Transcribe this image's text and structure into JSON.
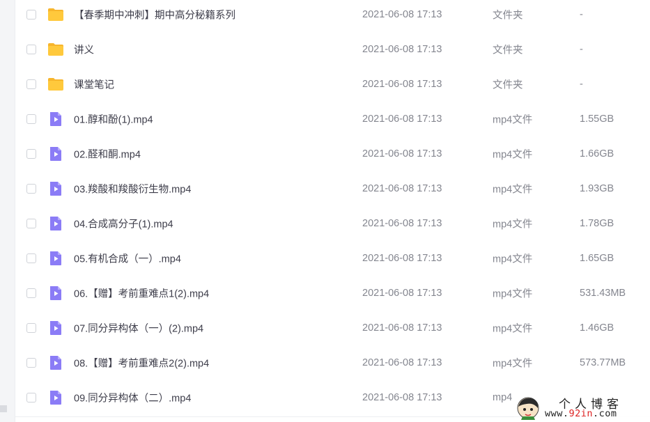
{
  "files": [
    {
      "name": "【春季期中冲刺】期中高分秘籍系列",
      "date": "2021-06-08 17:13",
      "type": "文件夹",
      "size": "-",
      "icon": "folder-icon"
    },
    {
      "name": "讲义",
      "date": "2021-06-08 17:13",
      "type": "文件夹",
      "size": "-",
      "icon": "folder-icon"
    },
    {
      "name": "课堂笔记",
      "date": "2021-06-08 17:13",
      "type": "文件夹",
      "size": "-",
      "icon": "folder-icon"
    },
    {
      "name": "01.醇和酚(1).mp4",
      "date": "2021-06-08 17:13",
      "type": "mp4文件",
      "size": "1.55GB",
      "icon": "video-file-icon"
    },
    {
      "name": "02.醛和酮.mp4",
      "date": "2021-06-08 17:13",
      "type": "mp4文件",
      "size": "1.66GB",
      "icon": "video-file-icon"
    },
    {
      "name": "03.羧酸和羧酸衍生物.mp4",
      "date": "2021-06-08 17:13",
      "type": "mp4文件",
      "size": "1.93GB",
      "icon": "video-file-icon"
    },
    {
      "name": "04.合成高分子(1).mp4",
      "date": "2021-06-08 17:13",
      "type": "mp4文件",
      "size": "1.78GB",
      "icon": "video-file-icon"
    },
    {
      "name": "05.有机合成（一）.mp4",
      "date": "2021-06-08 17:13",
      "type": "mp4文件",
      "size": "1.65GB",
      "icon": "video-file-icon"
    },
    {
      "name": "06.【赠】考前重难点1(2).mp4",
      "date": "2021-06-08 17:13",
      "type": "mp4文件",
      "size": "531.43MB",
      "icon": "video-file-icon"
    },
    {
      "name": "07.同分异构体（一）(2).mp4",
      "date": "2021-06-08 17:13",
      "type": "mp4文件",
      "size": "1.46GB",
      "icon": "video-file-icon"
    },
    {
      "name": "08.【赠】考前重难点2(2).mp4",
      "date": "2021-06-08 17:13",
      "type": "mp4文件",
      "size": "573.77MB",
      "icon": "video-file-icon"
    },
    {
      "name": "09.同分异构体（二）.mp4",
      "date": "2021-06-08 17:13",
      "type": "mp4",
      "size": "",
      "icon": "video-file-icon"
    }
  ],
  "watermark": {
    "title": "个人博客",
    "url_prefix": "www.",
    "url_highlight": "92in",
    "url_suffix": ".com",
    "avatar_icon": "cartoon-avatar-icon"
  },
  "colors": {
    "folder": "#ffc93c",
    "folder_tab": "#f7b52c",
    "video": "#8b7cf6",
    "text": "#3d3d4a",
    "muted": "#84868f"
  }
}
